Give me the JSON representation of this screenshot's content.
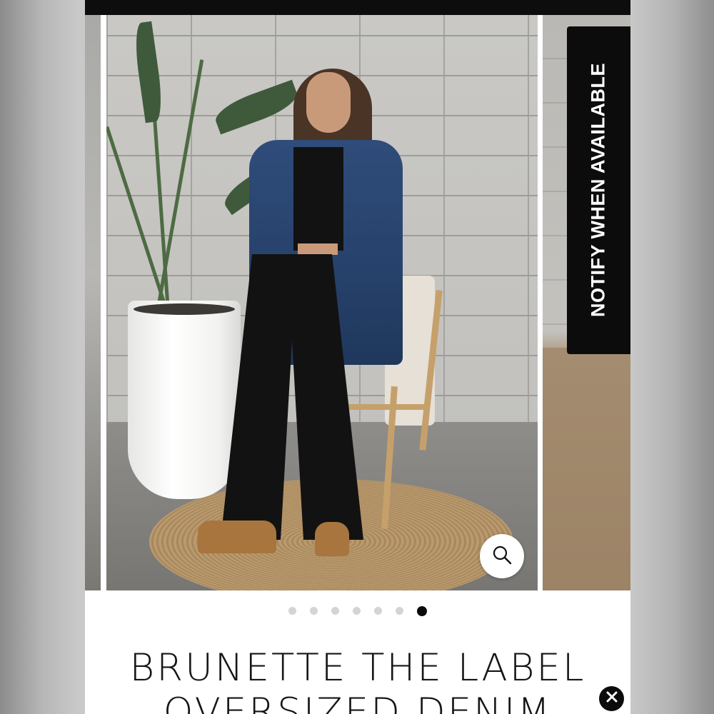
{
  "product": {
    "title_line1": "BRUNETTE THE LABEL",
    "title_line2": "OVERSIZED DENIM"
  },
  "notify_tab": {
    "label": "NOTIFY WHEN AVAILABLE"
  },
  "gallery": {
    "image_count": 7,
    "active_index": 6
  },
  "icons": {
    "zoom": "magnifier-icon",
    "close": "close-x-icon"
  },
  "colors": {
    "accent": "#0b0b0b",
    "dot_inactive": "#d4d4d4",
    "background": "#ffffff"
  }
}
